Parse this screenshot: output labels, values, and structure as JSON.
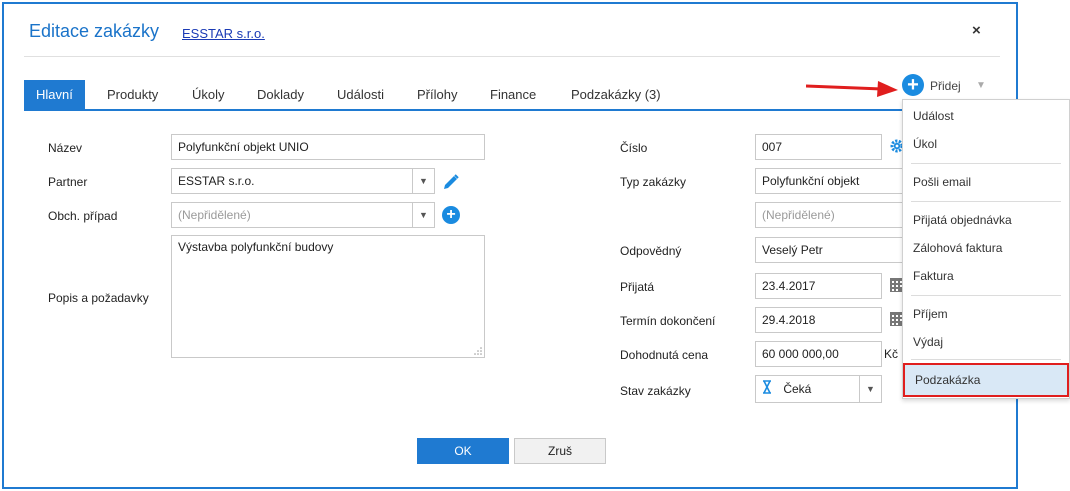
{
  "dialog": {
    "title": "Editace zakázky",
    "company_link": "ESSTAR s.r.o.",
    "close": "×"
  },
  "tabs": [
    {
      "label": "Hlavní",
      "active": true
    },
    {
      "label": "Produkty"
    },
    {
      "label": "Úkoly"
    },
    {
      "label": "Doklady"
    },
    {
      "label": "Události"
    },
    {
      "label": "Přílohy"
    },
    {
      "label": "Finance"
    },
    {
      "label": "Podzakázky (3)"
    }
  ],
  "add_button": {
    "label": "Přidej"
  },
  "left_form": {
    "name_label": "Název",
    "name_value": "Polyfunkční objekt UNIO",
    "partner_label": "Partner",
    "partner_value": "ESSTAR s.r.o.",
    "case_label": "Obch. případ",
    "case_placeholder": "(Nepřidělené)",
    "desc_label": "Popis a požadavky",
    "desc_value": "Výstavba polyfunkční budovy"
  },
  "right_form": {
    "number_label": "Číslo",
    "number_value": "007",
    "type_label": "Typ zakázky",
    "type_value": "Polyfunkční objekt",
    "type_extra_placeholder": "(Nepřidělené)",
    "responsible_label": "Odpovědný",
    "responsible_value": "Veselý Petr",
    "received_label": "Přijatá",
    "received_value": "23.4.2017",
    "deadline_label": "Termín dokončení",
    "deadline_value": "29.4.2018",
    "price_label": "Dohodnutá cena",
    "price_value": "60 000 000,00",
    "currency": "Kč",
    "status_label": "Stav zakázky",
    "status_value": "Čeká"
  },
  "buttons": {
    "ok": "OK",
    "cancel": "Zruš"
  },
  "menu": {
    "items": [
      "Událost",
      "Úkol",
      "Pošli email",
      "Přijatá objednávka",
      "Zálohová faktura",
      "Faktura",
      "Příjem",
      "Výdaj",
      "Podzakázka"
    ],
    "highlighted_index": 8
  },
  "colors": {
    "accent": "#1f7ad1",
    "highlight_border": "#e01e1e",
    "highlight_bg": "#d9e8f6"
  }
}
